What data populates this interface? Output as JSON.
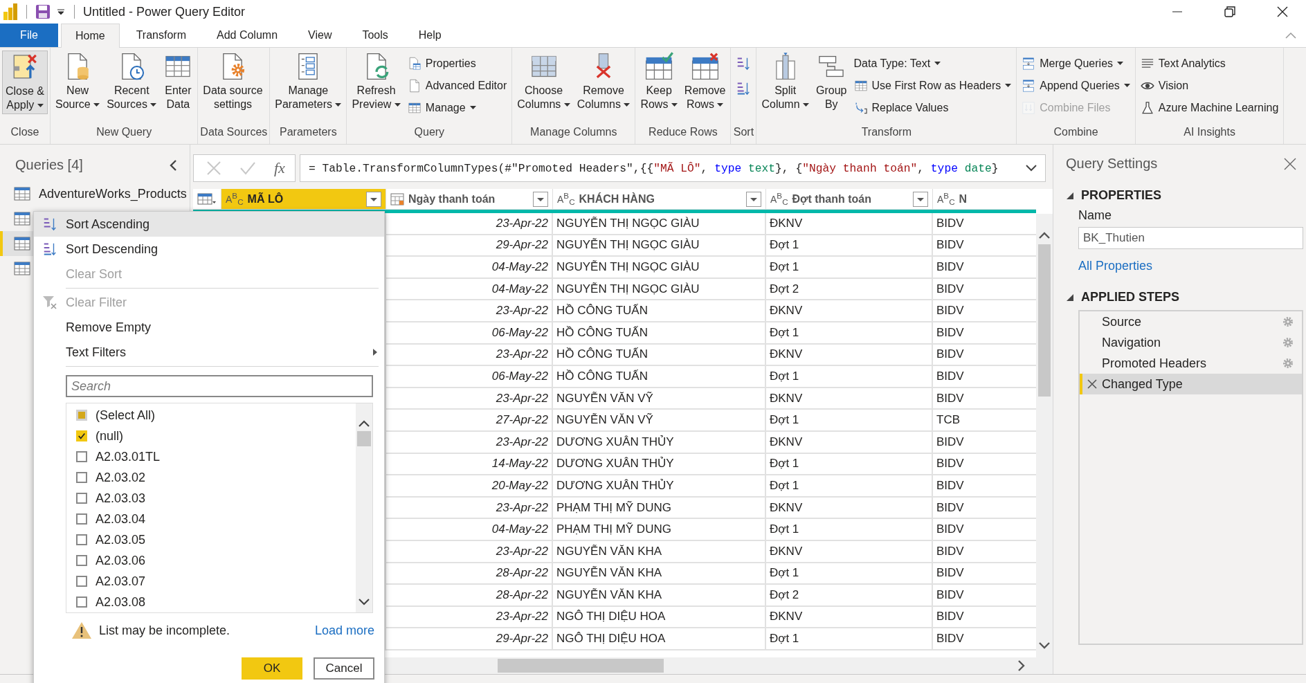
{
  "window": {
    "title": "Untitled - Power Query Editor"
  },
  "tabs": [
    {
      "label": "File",
      "kind": "file",
      "selected": false
    },
    {
      "label": "Home",
      "kind": "tab",
      "selected": true
    },
    {
      "label": "Transform",
      "kind": "tab",
      "selected": false
    },
    {
      "label": "Add Column",
      "kind": "tab",
      "selected": false
    },
    {
      "label": "View",
      "kind": "tab",
      "selected": false
    },
    {
      "label": "Tools",
      "kind": "tab",
      "selected": false
    },
    {
      "label": "Help",
      "kind": "tab",
      "selected": false
    }
  ],
  "ribbon": [
    {
      "label": "Close",
      "large": [
        {
          "lines": [
            "Close &",
            "Apply"
          ],
          "dropdown": true,
          "disabled": false
        }
      ]
    },
    {
      "label": "New Query",
      "large": [
        {
          "lines": [
            "New",
            "Source"
          ],
          "dropdown": true,
          "disabled": false
        },
        {
          "lines": [
            "Recent",
            "Sources"
          ],
          "dropdown": true,
          "disabled": false
        },
        {
          "lines": [
            "Enter",
            "Data"
          ],
          "dropdown": false,
          "disabled": false
        }
      ]
    },
    {
      "label": "Data Sources",
      "large": [
        {
          "lines": [
            "Data source",
            "settings"
          ],
          "dropdown": false,
          "disabled": false
        }
      ]
    },
    {
      "label": "Parameters",
      "large": [
        {
          "lines": [
            "Manage",
            "Parameters"
          ],
          "dropdown": true,
          "disabled": false
        }
      ]
    },
    {
      "label": "Query",
      "large": [
        {
          "lines": [
            "Refresh",
            "Preview"
          ],
          "dropdown": true,
          "disabled": false
        }
      ],
      "small": [
        {
          "label": "Properties",
          "dropdown": false,
          "disabled": false
        },
        {
          "label": "Advanced Editor",
          "dropdown": false,
          "disabled": false
        },
        {
          "label": "Manage",
          "dropdown": true,
          "disabled": false
        }
      ]
    },
    {
      "label": "Manage Columns",
      "large": [
        {
          "lines": [
            "Choose",
            "Columns"
          ],
          "dropdown": true,
          "disabled": false
        },
        {
          "lines": [
            "Remove",
            "Columns"
          ],
          "dropdown": true,
          "disabled": false
        }
      ]
    },
    {
      "label": "Reduce Rows",
      "large": [
        {
          "lines": [
            "Keep",
            "Rows"
          ],
          "dropdown": true,
          "disabled": false
        },
        {
          "lines": [
            "Remove",
            "Rows"
          ],
          "dropdown": true,
          "disabled": false
        }
      ]
    },
    {
      "label": "Sort",
      "small": [
        {
          "dropdown": false,
          "disabled": false
        },
        {
          "dropdown": false,
          "disabled": false
        }
      ]
    },
    {
      "label": "Transform",
      "large": [
        {
          "lines": [
            "Split",
            "Column"
          ],
          "dropdown": true,
          "disabled": false
        },
        {
          "lines": [
            "Group",
            "By"
          ],
          "dropdown": false,
          "disabled": false
        }
      ],
      "small": [
        {
          "label": "Data Type: Text",
          "dropdown": true,
          "disabled": false
        },
        {
          "label": "Use First Row as Headers",
          "dropdown": true,
          "disabled": false
        },
        {
          "label": "Replace Values",
          "dropdown": false,
          "disabled": false
        }
      ]
    },
    {
      "label": "Combine",
      "small": [
        {
          "label": "Merge Queries",
          "dropdown": true,
          "disabled": false
        },
        {
          "label": "Append Queries",
          "dropdown": true,
          "disabled": false
        },
        {
          "label": "Combine Files",
          "dropdown": false,
          "disabled": true
        }
      ]
    },
    {
      "label": "AI Insights",
      "small": [
        {
          "label": "Text Analytics",
          "dropdown": false,
          "disabled": false
        },
        {
          "label": "Vision",
          "dropdown": false,
          "disabled": false
        },
        {
          "label": "Azure Machine Learning",
          "dropdown": false,
          "disabled": false
        }
      ]
    }
  ],
  "queries": {
    "title": "Queries [4]",
    "items": [
      {
        "name": "AdventureWorks_Products",
        "selected": false
      },
      {
        "selected": false
      },
      {
        "selected": true
      },
      {
        "selected": false
      }
    ]
  },
  "formula_bar": {
    "fx_label": "fx",
    "formula": [
      {
        "kind": "plain",
        "text": "= Table.TransformColumnTypes(#\"Promoted Headers\",{{"
      },
      {
        "kind": "string",
        "text": "\"MÃ LÔ\""
      },
      {
        "kind": "plain",
        "text": ","
      },
      {
        "kind": "keyword",
        "text": "type"
      },
      {
        "kind": "type",
        "text": "text"
      },
      {
        "kind": "plain",
        "text": "}, {"
      },
      {
        "kind": "string",
        "text": "\"Ngày thanh toán\""
      },
      {
        "kind": "plain",
        "text": ","
      },
      {
        "kind": "keyword",
        "text": "type"
      },
      {
        "kind": "type",
        "text": "date"
      },
      {
        "kind": "plain",
        "text": "}"
      }
    ]
  },
  "table": {
    "columns": [
      {
        "name": "MÃ LÔ",
        "kind": "text",
        "type_label": "A$^{B}$$_{C}$",
        "selected": true,
        "filter": true
      },
      {
        "name": "Ngày thanh toán",
        "kind": "date",
        "selected": false,
        "filter": true
      },
      {
        "name": "KHÁCH HÀNG",
        "kind": "text",
        "type_label": "A$^{B}$$_{C}$",
        "selected": false,
        "filter": true
      },
      {
        "name": "Đợt thanh toán",
        "kind": "text",
        "type_label": "A$^{B}$$_{C}$",
        "selected": false,
        "filter": true
      },
      {
        "name": "N",
        "kind": "text",
        "type_label": "A$^{B}$$_{C}$",
        "selected": false,
        "filter": false
      }
    ],
    "rows": [
      [
        "",
        "23-Apr-22",
        "NGUYỄN THỊ NGỌC GIÀU",
        "ĐKNV",
        "BIDV"
      ],
      [
        "",
        "29-Apr-22",
        "NGUYỄN THỊ NGỌC GIÀU",
        "Đợt 1",
        "BIDV"
      ],
      [
        "",
        "04-May-22",
        "NGUYỄN THỊ NGỌC GIÀU",
        "Đợt 1",
        "BIDV"
      ],
      [
        "",
        "04-May-22",
        "NGUYỄN THỊ NGỌC GIÀU",
        "Đợt 2",
        "BIDV"
      ],
      [
        "",
        "23-Apr-22",
        "HỒ CÔNG TUẤN",
        "ĐKNV",
        "BIDV"
      ],
      [
        "",
        "06-May-22",
        "HỒ CÔNG TUẤN",
        "Đợt 1",
        "BIDV"
      ],
      [
        "",
        "23-Apr-22",
        "HỒ CÔNG TUẤN",
        "ĐKNV",
        "BIDV"
      ],
      [
        "",
        "06-May-22",
        "HỒ CÔNG TUẤN",
        "Đợt 1",
        "BIDV"
      ],
      [
        "",
        "23-Apr-22",
        "NGUYỄN VĂN VỸ",
        "ĐKNV",
        "BIDV"
      ],
      [
        "",
        "27-Apr-22",
        "NGUYỄN VĂN VỸ",
        "Đợt 1",
        "TCB"
      ],
      [
        "",
        "23-Apr-22",
        "DƯƠNG XUÂN THỦY",
        "ĐKNV",
        "BIDV"
      ],
      [
        "",
        "14-May-22",
        "DƯƠNG XUÂN THỦY",
        "Đợt 1",
        "BIDV"
      ],
      [
        "",
        "20-May-22",
        "DƯƠNG XUÂN THỦY",
        "Đợt 1",
        "BIDV"
      ],
      [
        "",
        "23-Apr-22",
        "PHẠM THỊ MỸ DUNG",
        "ĐKNV",
        "BIDV"
      ],
      [
        "",
        "04-May-22",
        "PHẠM THỊ MỸ DUNG",
        "Đợt 1",
        "BIDV"
      ],
      [
        "",
        "23-Apr-22",
        "NGUYỄN VĂN KHA",
        "ĐKNV",
        "BIDV"
      ],
      [
        "",
        "28-Apr-22",
        "NGUYỄN VĂN KHA",
        "Đợt 1",
        "BIDV"
      ],
      [
        "",
        "28-Apr-22",
        "NGUYỄN VĂN KHA",
        "Đợt 2",
        "BIDV"
      ],
      [
        "",
        "23-Apr-22",
        "NGÔ THỊ DIỆU HOA",
        "ĐKNV",
        "BIDV"
      ],
      [
        "",
        "29-Apr-22",
        "NGÔ THỊ DIỆU HOA",
        "Đợt 1",
        "BIDV"
      ]
    ]
  },
  "filter_menu": {
    "items": [
      {
        "label": "Sort Ascending",
        "kind": "sort_asc",
        "highlighted": true,
        "disabled": false
      },
      {
        "label": "Sort Descending",
        "kind": "sort_desc",
        "highlighted": false,
        "disabled": false
      },
      {
        "label": "Clear Sort",
        "kind": "plain",
        "highlighted": false,
        "disabled": true
      },
      {
        "kind": "divider"
      },
      {
        "label": "Clear Filter",
        "kind": "clear_filter",
        "highlighted": false,
        "disabled": true
      },
      {
        "label": "Remove Empty",
        "kind": "plain",
        "highlighted": false,
        "disabled": false
      },
      {
        "label": "Text Filters",
        "kind": "submenu",
        "highlighted": false,
        "disabled": false
      },
      {
        "kind": "divider"
      }
    ],
    "search": {
      "placeholder": "Search"
    },
    "values": [
      {
        "label": "(Select All)",
        "checked": false,
        "indeterminate": true
      },
      {
        "label": "(null)",
        "checked": true,
        "indeterminate": false
      },
      {
        "label": "A2.03.01TL",
        "checked": false,
        "indeterminate": false
      },
      {
        "label": "A2.03.02",
        "checked": false,
        "indeterminate": false
      },
      {
        "label": "A2.03.03",
        "checked": false,
        "indeterminate": false
      },
      {
        "label": "A2.03.04",
        "checked": false,
        "indeterminate": false
      },
      {
        "label": "A2.03.05",
        "checked": false,
        "indeterminate": false
      },
      {
        "label": "A2.03.06",
        "checked": false,
        "indeterminate": false
      },
      {
        "label": "A2.03.07",
        "checked": false,
        "indeterminate": false
      },
      {
        "label": "A2.03.08",
        "checked": false,
        "indeterminate": false
      }
    ],
    "warning": "List may be incomplete.",
    "load_more": "Load more",
    "buttons": [
      {
        "label": "OK",
        "primary": true
      },
      {
        "label": "Cancel",
        "primary": false
      }
    ]
  },
  "query_settings": {
    "title": "Query Settings",
    "properties": {
      "heading": "PROPERTIES",
      "name_label": "Name",
      "name_value": "BK_Thutien",
      "link": "All Properties"
    },
    "steps_heading": "APPLIED STEPS",
    "steps": [
      {
        "label": "Source",
        "selected": false,
        "settings": true
      },
      {
        "label": "Navigation",
        "selected": false,
        "settings": true
      },
      {
        "label": "Promoted Headers",
        "selected": false,
        "settings": true
      },
      {
        "label": "Changed Type",
        "selected": true,
        "settings": false
      }
    ]
  }
}
